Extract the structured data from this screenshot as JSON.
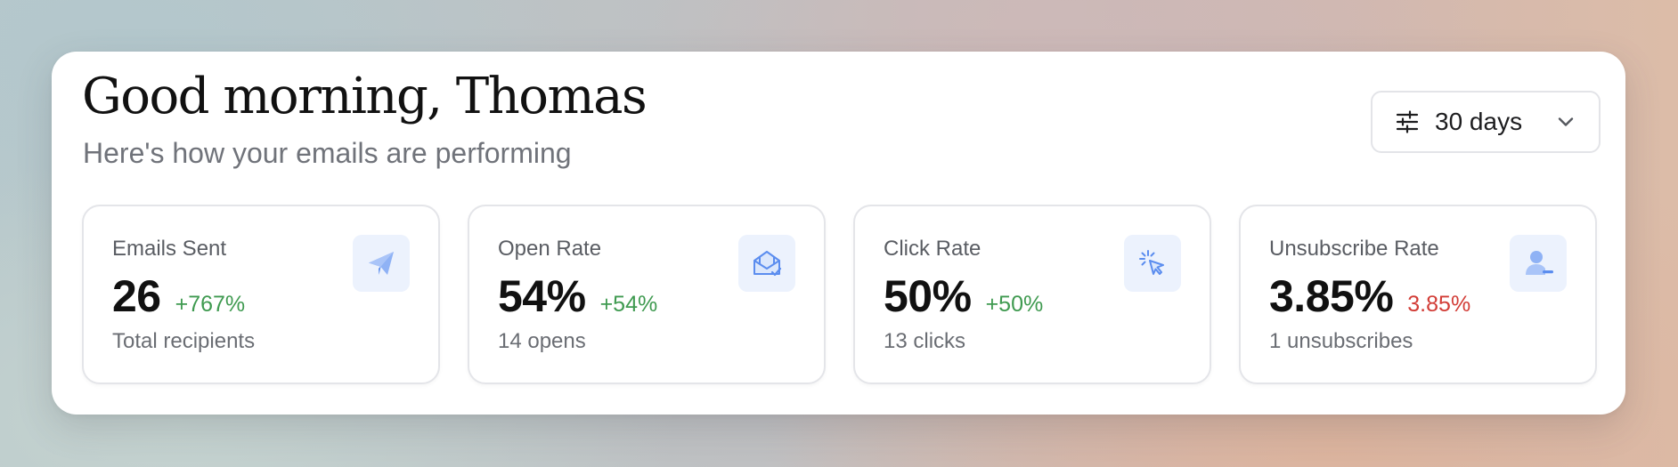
{
  "header": {
    "greeting": "Good morning, Thomas",
    "subtitle": "Here's how your emails are performing"
  },
  "range_filter": {
    "label": "30 days",
    "icon": "sliders-icon",
    "chevron_icon": "chevron-down-icon"
  },
  "colors": {
    "positive": "#3f9a50",
    "negative": "#d23c36",
    "icon_accent": "#5b8def",
    "icon_badge_bg": "#ecf2fd"
  },
  "cards": [
    {
      "title": "Emails Sent",
      "value": "26",
      "change": "+767%",
      "change_trend": "up",
      "detail": "Total recipients",
      "icon": "paper-plane-icon"
    },
    {
      "title": "Open Rate",
      "value": "54%",
      "change": "+54%",
      "change_trend": "up",
      "detail": "14 opens",
      "icon": "opened-envelope-icon"
    },
    {
      "title": "Click Rate",
      "value": "50%",
      "change": "+50%",
      "change_trend": "up",
      "detail": "13 clicks",
      "icon": "cursor-click-icon"
    },
    {
      "title": "Unsubscribe Rate",
      "value": "3.85%",
      "change": "3.85%",
      "change_trend": "down",
      "detail": "1 unsubscribes",
      "icon": "user-minus-icon"
    }
  ]
}
